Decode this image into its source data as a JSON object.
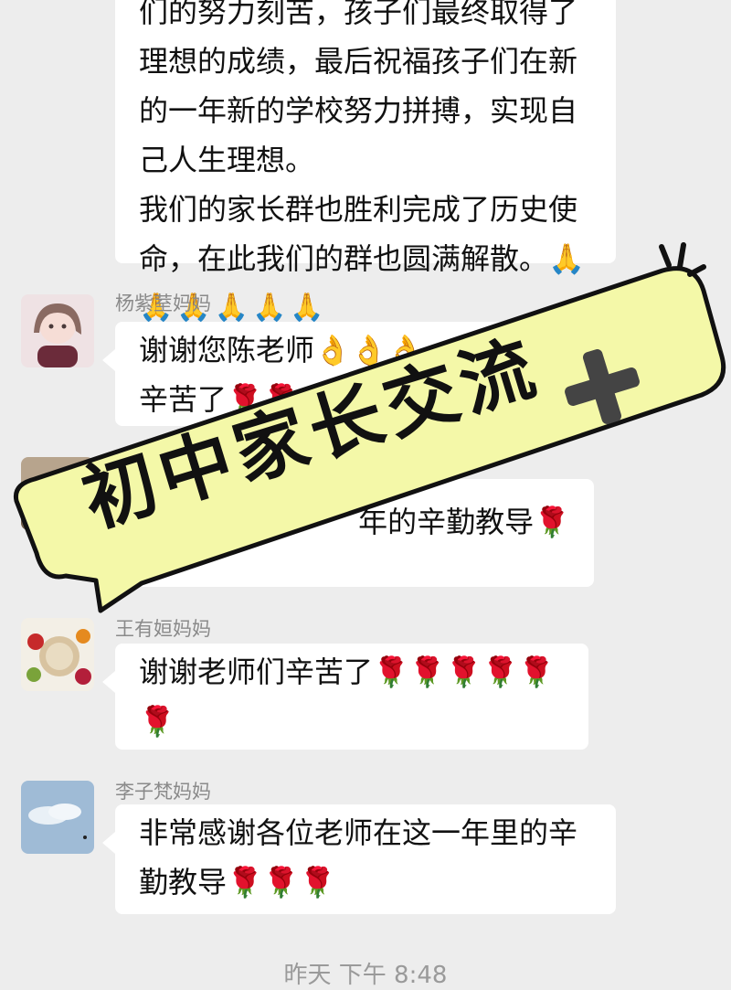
{
  "messages": [
    {
      "lines": [
        "们的努力刻苦，孩子们最终取得了",
        "理想的成绩，最后祝福孩子们在新",
        "的一年新的学校努力拼搏，实现自",
        "己人生理想。",
        "我们的家长群也胜利完成了历史使",
        "命，在此我们的群也圆满解散。🙏",
        "🙏🙏🙏🙏🙏"
      ]
    },
    {
      "sender": "杨紫荎妈妈",
      "lines": [
        "谢谢您陈老师👌👌👌",
        "辛苦了🌹🌹"
      ]
    },
    {
      "sender": "",
      "lines": [
        "年的辛勤教导🌹"
      ]
    },
    {
      "sender": "王有姮妈妈",
      "lines": [
        "谢谢老师们辛苦了🌹🌹🌹🌹🌹",
        "🌹"
      ]
    },
    {
      "sender": "李子梵妈妈",
      "lines": [
        "非常感谢各位老师在这一年里的辛",
        "勤教导🌹🌹🌹"
      ]
    }
  ],
  "timestamp": "昨天 下午 8:48",
  "overlay": {
    "text": "初中家长交流",
    "plus": "+",
    "color": "#f4f8a8"
  }
}
